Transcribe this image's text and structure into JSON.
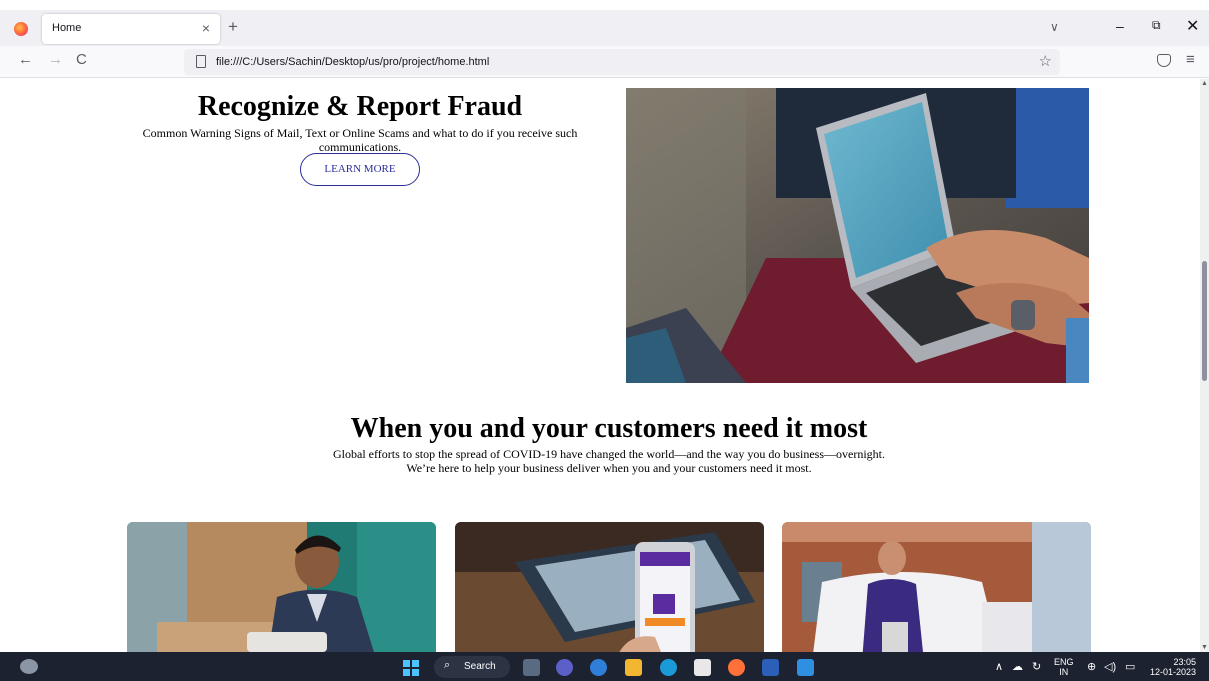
{
  "browser": {
    "tab_title": "Home",
    "tab_close": "×",
    "new_tab": "+",
    "url": "file:///C:/Users/Sachin/Desktop/us/pro/project/home.html",
    "icons": {
      "back": "←",
      "forward": "→",
      "reload": "C",
      "star": "☆",
      "menu": "≡",
      "tab_list": "∨",
      "minimize": "–",
      "maximize": "⧉",
      "close": "✕"
    }
  },
  "page": {
    "hero": {
      "title": "Recognize & Report Fraud",
      "subtitle": "Common Warning Signs of Mail, Text or Online Scams and what to do if you receive such communications.",
      "button": "LEARN MORE"
    },
    "section": {
      "title": "When you and your customers need it most",
      "line1": "Global efforts to stop the spread of COVID-19 have changed the world—and the way you do business—overnight.",
      "line2": "We’re here to help your business deliver when you and your customers need it most."
    }
  },
  "taskbar": {
    "search_label": "Search",
    "search_icon": "⌕",
    "lang_line1": "ENG",
    "lang_line2": "IN",
    "time": "23:05",
    "date": "12-01-2023",
    "tray_chevron": "∧"
  },
  "colors": {
    "button_border": "#2a2f9a",
    "taskbar_bg": "#1c2230"
  }
}
